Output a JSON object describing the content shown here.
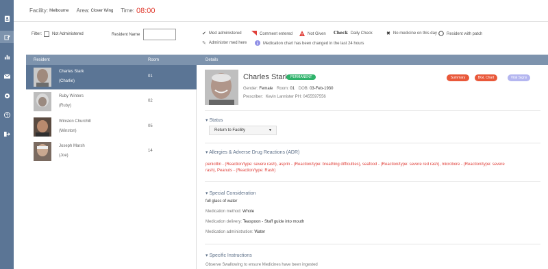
{
  "sidebar": {
    "icons": [
      "user-icon",
      "edit-icon",
      "bar-chart-icon",
      "envelope-icon",
      "gear-icon",
      "help-icon",
      "sign-out-icon"
    ]
  },
  "topbar": {
    "facility_label": "Facility:",
    "facility_value": "Melbourne",
    "area_label": "Area:",
    "area_value": "Clover Wing",
    "time_label": "Time:",
    "time_value": "08:00"
  },
  "filter": {
    "filter_label": "Filter:",
    "not_administered_label": "Not Administered",
    "resident_name_label": "Resident Name",
    "resident_name_value": ""
  },
  "legend": {
    "med_administered": "Med administered",
    "comment_entered": "Comment entered",
    "not_given": "Not Given",
    "daily_check_glyph": "Check",
    "daily_check": "Daily Check",
    "no_medicine": "No medicine on this day",
    "resident_with_patch": "Resident with patch",
    "administer_med_here": "Administer med here",
    "chart_changed": "Medication chart has been changed in the last 24 hours"
  },
  "list": {
    "col_resident": "Resident",
    "col_room": "Room",
    "col_details": "Details",
    "residents": [
      {
        "name": "Charles Stark",
        "nick": "(Charlie)",
        "room": "01"
      },
      {
        "name": "Ruby Winters",
        "nick": "(Ruby)",
        "room": "02"
      },
      {
        "name": "Winston Churchill",
        "nick": "(Winston)",
        "room": "05"
      },
      {
        "name": "Joseph Marsh",
        "nick": "(Joe)",
        "room": "14"
      }
    ]
  },
  "details": {
    "name": "Charles Stark",
    "badge": "PERMANENT",
    "gender_label": "Gender:",
    "gender": "Female",
    "room_label": "Room:",
    "room": "01",
    "dob_label": "DOB:",
    "dob": "03-Feb-1930",
    "prescriber_label": "Prescriber:",
    "prescriber": "Kevin Lannister PH: 0455597556",
    "buttons": {
      "summary": "Summary",
      "bgl_chart": "BGL Chart",
      "vital_signs": "Vital Signs"
    },
    "status_title": "Status",
    "status_value": "Return to Facility",
    "allergies_title": "Allergies & Adverse Drug Reactions (ADR)",
    "allergies_line1": "penicillin - (Reaction/type: severe rash), asprin - (Reaction/type: breathing difficulties), seafood - (Reaction/type: severe red rash), microbore - (Reaction/type: severe",
    "allergies_line2": "rash), Peanuts - (Reaction/type: Rash)",
    "special_title": "Special Consideration",
    "special_note": "full glass of water",
    "method_label": "Medication method:",
    "method_value": "Whole",
    "delivery_label": "Medication delivery:",
    "delivery_value": "Teaspoon - Staff guide into mouth",
    "administration_label": "Medication administration:",
    "administration_value": "Water",
    "specific_title": "Specific Instructions",
    "specific_note": "Observe Swallowing to ensure Medicines have been ingested"
  },
  "colors": {
    "sidebar": "#5b7595",
    "header": "#7d93ad",
    "time": "#e03a2e",
    "badge": "#2fb36b",
    "summary": "#e9583a",
    "bgl": "#e9583a",
    "vital": "#b4b6f0",
    "allergy": "#e0403a"
  }
}
